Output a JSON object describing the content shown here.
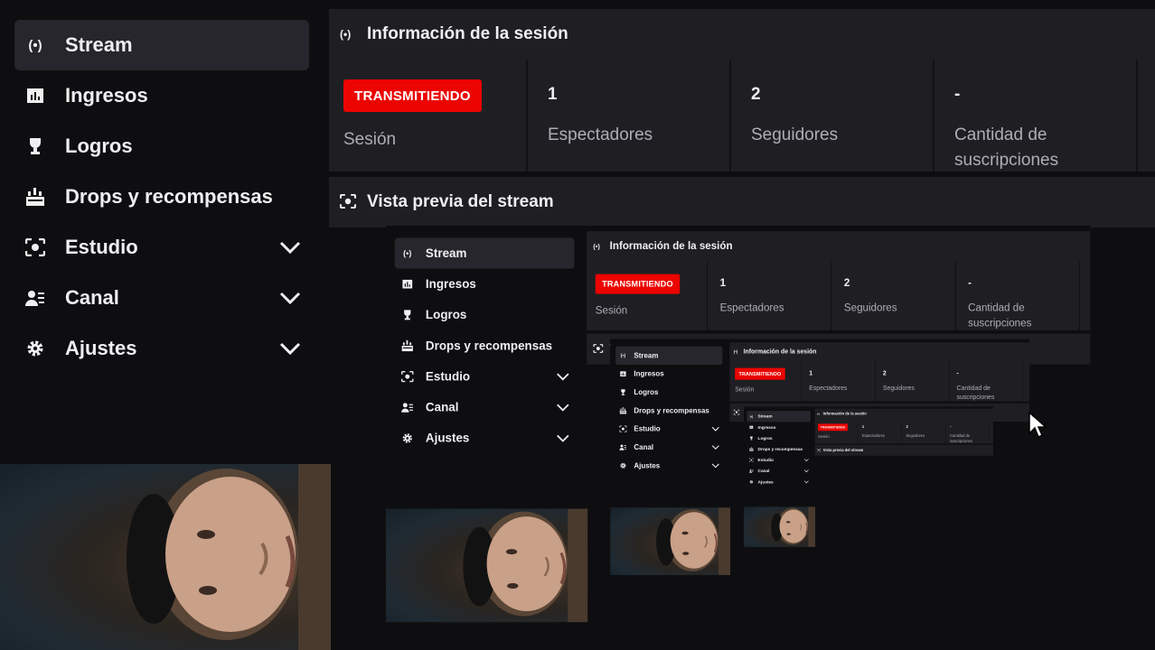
{
  "sidebar": {
    "items": [
      {
        "label": "Stream",
        "icon": "broadcast-icon",
        "active": true,
        "expandable": false
      },
      {
        "label": "Ingresos",
        "icon": "bar-chart-icon",
        "active": false,
        "expandable": false
      },
      {
        "label": "Logros",
        "icon": "trophy-icon",
        "active": false,
        "expandable": false
      },
      {
        "label": "Drops y recompensas",
        "icon": "gift-icon",
        "active": false,
        "expandable": false
      },
      {
        "label": "Estudio",
        "icon": "studio-icon",
        "active": false,
        "expandable": true
      },
      {
        "label": "Canal",
        "icon": "people-icon",
        "active": false,
        "expandable": true
      },
      {
        "label": "Ajustes",
        "icon": "gear-icon",
        "active": false,
        "expandable": true
      }
    ]
  },
  "session": {
    "title": "Información de la sesión",
    "status_badge": "TRANSMITIENDO",
    "status_label": "Sesión",
    "stats": [
      {
        "value": "1",
        "label": "Espectadores"
      },
      {
        "value": "2",
        "label": "Seguidores"
      },
      {
        "value": "-",
        "label": "Cantidad de suscripciones"
      }
    ]
  },
  "preview": {
    "title": "Vista previa del stream"
  },
  "colors": {
    "background": "#0e0e10",
    "panel": "#1f1f23",
    "active_item": "#26262c",
    "badge_red": "#eb0400",
    "muted_text": "#adadb8"
  }
}
